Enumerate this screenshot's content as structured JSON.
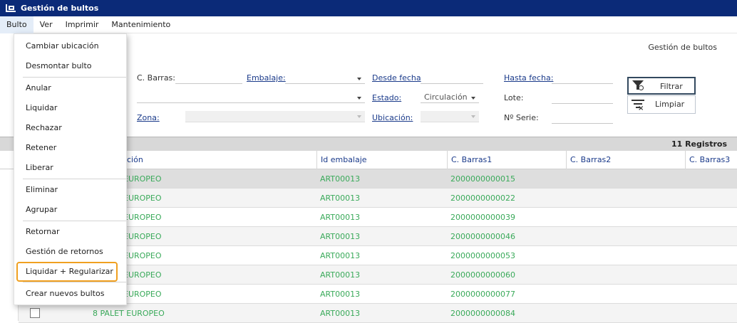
{
  "window": {
    "title": "Gestión de bultos"
  },
  "menubar": {
    "items": [
      "Bulto",
      "Ver",
      "Imprimir",
      "Mantenimiento"
    ]
  },
  "page_title": "Gestión de bultos",
  "filters": {
    "cbarras_label": "C. Barras:",
    "embalaje_label": "Embalaje:",
    "desde_label": "Desde fecha",
    "hasta_label": "Hasta fecha:",
    "zona_label": "Zona:",
    "estado_label": "Estado:",
    "estado_value": "Circulación",
    "lote_label": "Lote:",
    "ubicacion_label": "Ubicación:",
    "nserie_label": "Nº Serie:",
    "filtrar_label": "Filtrar",
    "limpiar_label": "Limpiar"
  },
  "grid": {
    "count_label": "11 Registros",
    "columns": [
      "pción",
      "Id embalaje",
      "C. Barras1",
      "C. Barras2",
      "C. Barras3"
    ],
    "rows": [
      {
        "desc": "EUROPEO",
        "id": "ART00013",
        "cb1": "2000000000015"
      },
      {
        "desc": "EUROPEO",
        "id": "ART00013",
        "cb1": "2000000000022"
      },
      {
        "desc": "EUROPEO",
        "id": "ART00013",
        "cb1": "2000000000039"
      },
      {
        "desc": "EUROPEO",
        "id": "ART00013",
        "cb1": "2000000000046"
      },
      {
        "desc": "EUROPEO",
        "id": "ART00013",
        "cb1": "2000000000053"
      },
      {
        "desc": "EUROPEO",
        "id": "ART00013",
        "cb1": "2000000000060"
      },
      {
        "desc": "EUROPEO",
        "id": "ART00013",
        "cb1": "2000000000077"
      },
      {
        "desc": "8  PALET EUROPEO",
        "id": "ART00013",
        "cb1": "2000000000084"
      }
    ]
  },
  "dropdown": {
    "items": [
      "Cambiar ubicación",
      "Desmontar bulto",
      "Anular",
      "Liquidar",
      "Rechazar",
      "Retener",
      "Liberar",
      "Eliminar",
      "Agrupar",
      "Retornar",
      "Gestión de retornos",
      "Liquidar + Regularizar",
      "Crear nuevos bultos"
    ]
  }
}
